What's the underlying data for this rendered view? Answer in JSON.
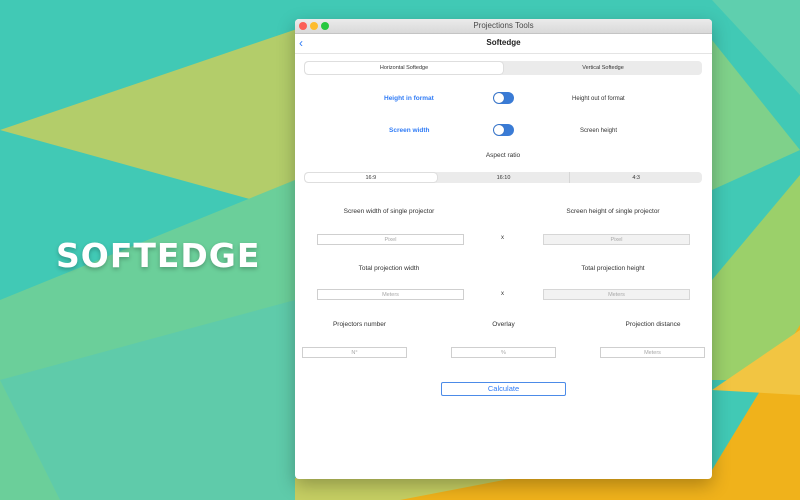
{
  "background": {
    "colors": [
      "#41c9b5",
      "#b3cd6a",
      "#6bcf9a",
      "#f0b21b"
    ]
  },
  "promo": {
    "headline": "SOFTEDGE"
  },
  "window": {
    "title": "Projections Tools",
    "nav_title": "Softedge",
    "back_icon": "chevron-left-icon",
    "accent_color": "#2f7bf6"
  },
  "mode_segment": {
    "options": [
      "Horizontal Softedge",
      "Vertical Softedge"
    ],
    "selected": "Horizontal Softedge"
  },
  "toggles": [
    {
      "left_label": "Height in format",
      "right_label": "Height out of format",
      "state": "on"
    },
    {
      "left_label": "Screen width",
      "right_label": "Screen height",
      "state": "on"
    }
  ],
  "aspect_ratio": {
    "label": "Aspect ratio",
    "options": [
      "16:9",
      "16:10",
      "4:3"
    ],
    "selected": "16:9"
  },
  "projector_size": {
    "width_label": "Screen width of single projector",
    "height_label": "Screen height of single projector",
    "width_placeholder": "Pixel",
    "height_placeholder": "Pixel",
    "separator": "x"
  },
  "projection_size": {
    "width_label": "Total projection width",
    "height_label": "Total projection height",
    "width_placeholder": "Meters",
    "height_placeholder": "Meters",
    "separator": "x"
  },
  "bottom_fields": {
    "projectors_label": "Projectors number",
    "projectors_placeholder": "N°",
    "overlay_label": "Overlay",
    "overlay_placeholder": "%",
    "distance_label": "Projection distance",
    "distance_placeholder": "Meters"
  },
  "calculate_label": "Calculate"
}
